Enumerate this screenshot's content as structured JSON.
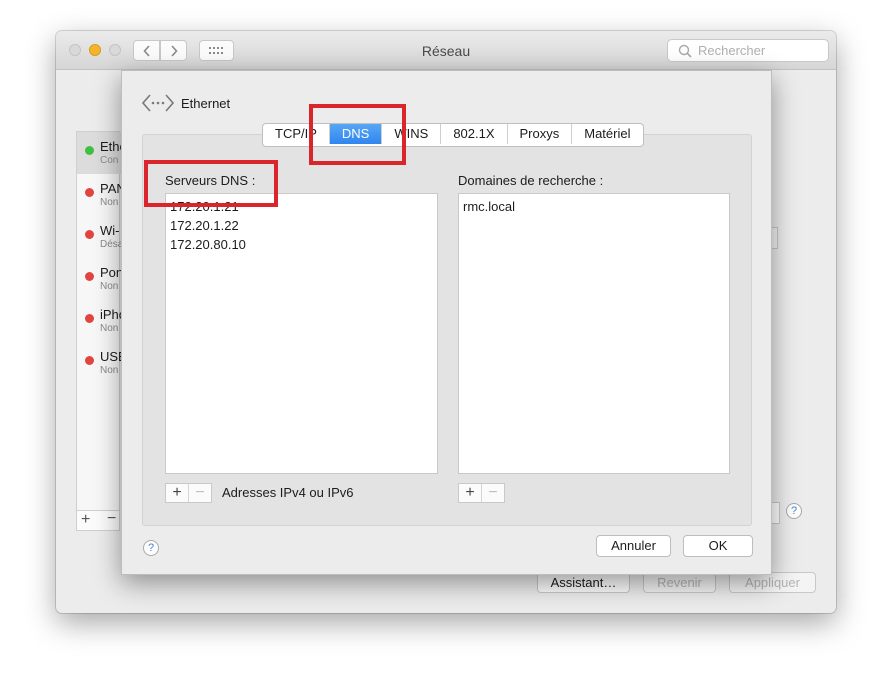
{
  "window": {
    "title": "Réseau",
    "search_placeholder": "Rechercher"
  },
  "sidebar": {
    "services": [
      {
        "name": "Ethe",
        "status": "Con",
        "color": "#3fc13f"
      },
      {
        "name": "PAN",
        "status": "Non",
        "color": "#e0463f"
      },
      {
        "name": "Wi-",
        "status": "Désa",
        "color": "#e0463f"
      },
      {
        "name": "Pon",
        "status": "Non",
        "color": "#e0463f"
      },
      {
        "name": "iPho",
        "status": "Non",
        "color": "#e0463f"
      },
      {
        "name": "USB",
        "status": "Non",
        "color": "#e0463f"
      }
    ],
    "add_label": "+",
    "remove_label": "−"
  },
  "footer": {
    "assistant_label": "Assistant…",
    "revenir_label": "Revenir",
    "appliquer_label": "Appliquer",
    "help_label": "?"
  },
  "sheet": {
    "interface_name": "Ethernet",
    "tabs": [
      {
        "label": "TCP/IP",
        "active": false
      },
      {
        "label": "DNS",
        "active": true
      },
      {
        "label": "WINS",
        "active": false
      },
      {
        "label": "802.1X",
        "active": false
      },
      {
        "label": "Proxys",
        "active": false
      },
      {
        "label": "Matériel",
        "active": false
      }
    ],
    "dns_label": "Serveurs DNS :",
    "dns_servers": [
      "172.20.1.21",
      "172.20.1.22",
      "172.20.80.10"
    ],
    "domains_label": "Domaines de recherche :",
    "search_domains": [
      "rmc.local"
    ],
    "add_label": "+",
    "remove_label": "−",
    "ip_hint": "Adresses IPv4 ou IPv6",
    "help_label": "?",
    "cancel_label": "Annuler",
    "ok_label": "OK"
  },
  "colors": {
    "annotation": "#d9252b",
    "accent": "#2f86ef"
  }
}
